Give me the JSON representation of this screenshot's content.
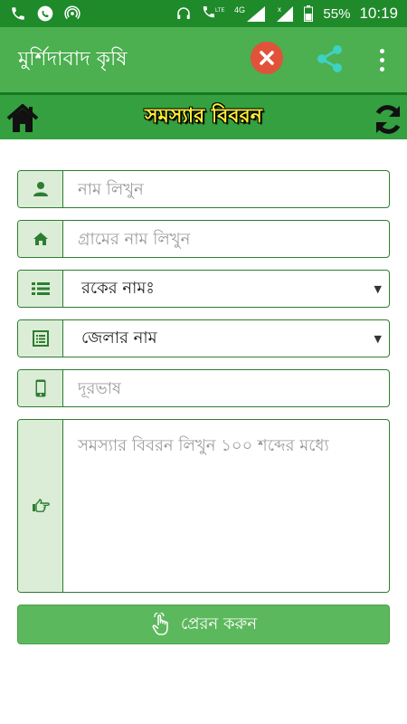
{
  "status_bar": {
    "battery": "55%",
    "time": "10:19",
    "network": "4G",
    "lte": "LTE"
  },
  "app_bar": {
    "title": "মুর্শিদাবাদ কৃষি"
  },
  "sub_bar": {
    "title": "সমস্যার বিবরন"
  },
  "form": {
    "name": {
      "placeholder": "নাম লিখুন",
      "icon": "user-icon"
    },
    "village": {
      "placeholder": "গ্রামের নাম লিখুন",
      "icon": "home-icon"
    },
    "block": {
      "value": "রকের নামঃ",
      "icon": "list-icon"
    },
    "district": {
      "value": "জেলার নাম",
      "icon": "list-alt-icon"
    },
    "phone": {
      "placeholder": "দূরভাষ",
      "icon": "mobile-icon"
    },
    "description": {
      "placeholder": "সমস্যার বিবরন লিখুন ১০০ শব্দের মধ্যে",
      "icon": "hand-point-icon"
    }
  },
  "submit": {
    "label": "প্রেরন করুন"
  },
  "colors": {
    "status_bar": "#1f8a2a",
    "app_bar": "#4caf50",
    "sub_bar": "#34a040",
    "field_border": "#2e7d32",
    "icon_bg": "#dcedd7",
    "submit_bg": "#5cb85c",
    "title_yellow": "#ffee33",
    "close_red": "#e0533a",
    "share_teal": "#3fd1c2"
  }
}
